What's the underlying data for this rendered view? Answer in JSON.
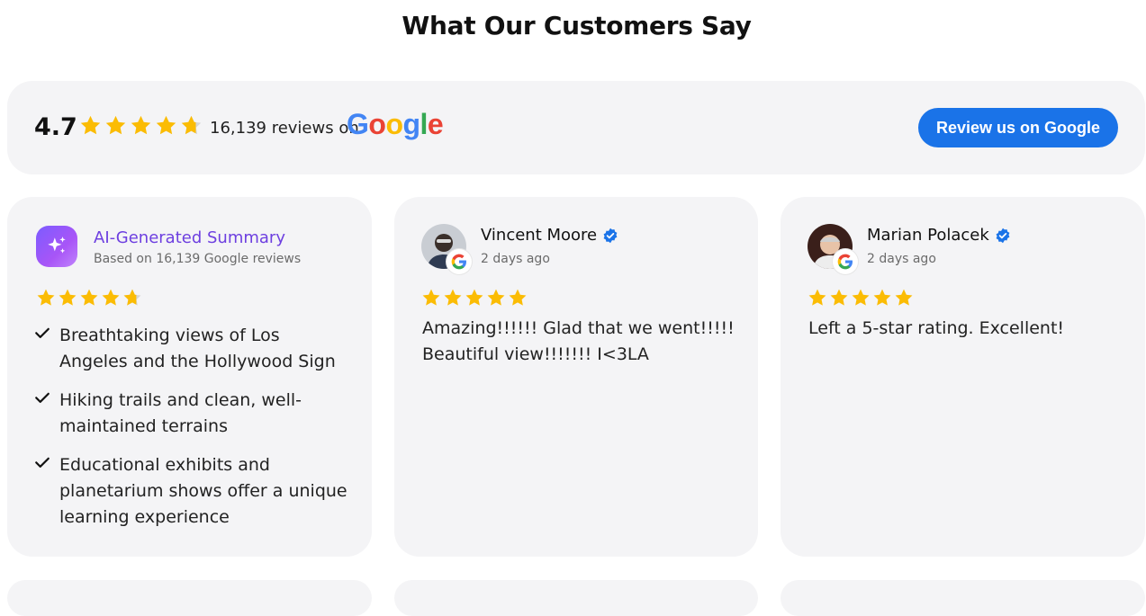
{
  "header": {
    "title": "What Our Customers Say"
  },
  "summary_bar": {
    "rating": "4.7",
    "rating_value": 4.7,
    "reviews_text": "16,139 reviews on",
    "provider": "Google",
    "button_label": "Review us on Google",
    "colors": {
      "star": "#FBBC04",
      "button": "#1A73E8"
    }
  },
  "ai_summary": {
    "title": "AI-Generated Summary",
    "subtitle": "Based on 16,139 Google reviews",
    "rating_value": 4.7,
    "points": [
      "Breathtaking views of Los Angeles and the Hollywood Sign",
      "Hiking trails and clean, well-maintained terrains",
      "Educational exhibits and planetarium shows offer a unique learning experience"
    ]
  },
  "reviews": [
    {
      "name": "Vincent Moore",
      "verified": true,
      "date": "2 days ago",
      "rating": 5,
      "text": "Amazing!!!!!! Glad that we went!!!!! Beautiful view!!!!!!! I<3LA"
    },
    {
      "name": "Marian Polacek",
      "verified": true,
      "date": "2 days ago",
      "rating": 5,
      "text": "Left a 5-star rating. Excellent!"
    }
  ]
}
